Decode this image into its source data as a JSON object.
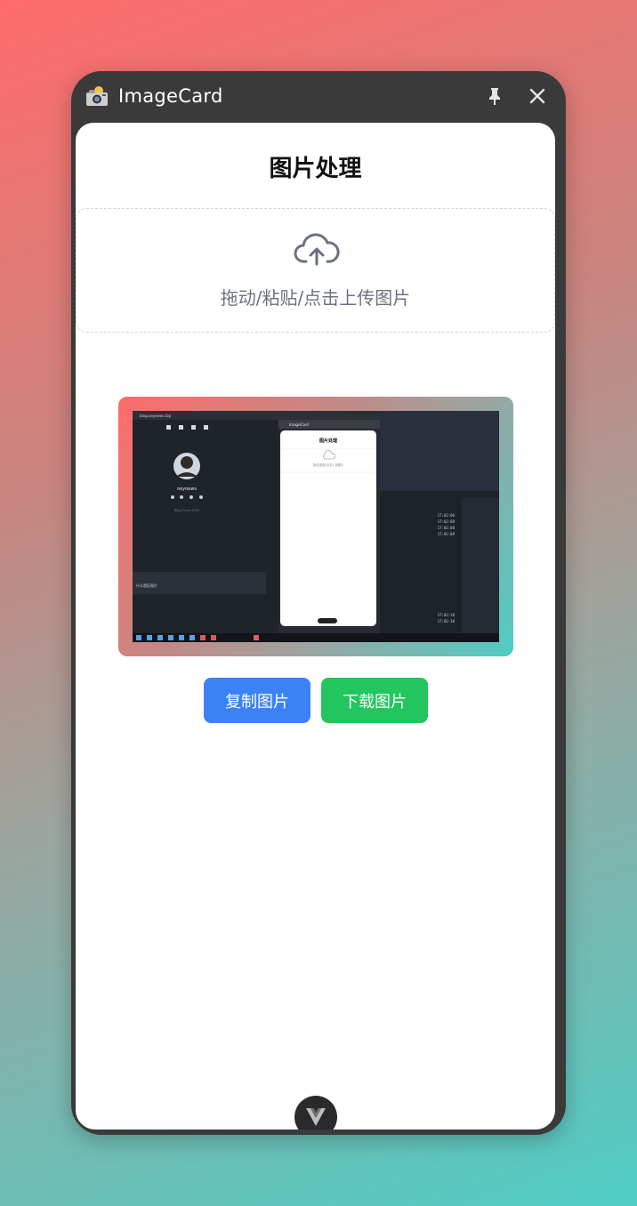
{
  "window": {
    "title": "ImageCard",
    "icons": {
      "app": "camera-icon",
      "pin": "pin-icon",
      "close": "close-icon"
    }
  },
  "main": {
    "page_title": "图片处理",
    "dropzone": {
      "icon": "cloud-upload-icon",
      "text": "拖动/粘贴/点击上传图片"
    },
    "preview": {
      "inner": {
        "tab_title": "blog.oeyoews.top",
        "profile_name": "oeyoews",
        "profile_sub": "Blog Since 2022",
        "card_title": "ImageCard",
        "card_heading": "图片处理",
        "card_hint": "拖动/粘贴/点击上传图片",
        "list_item": "什么是区图片",
        "times": [
          "17:02:06",
          "17:02:08",
          "17:02:08",
          "17:02:09",
          "17:02:10",
          "17:02:10"
        ]
      }
    },
    "buttons": {
      "copy": "复制图片",
      "download": "下载图片"
    }
  },
  "footer": {
    "logo": "vue-logo-icon"
  },
  "colors": {
    "copy_button": "#3b82f6",
    "download_button": "#22c55e",
    "window_frame": "#3a3a3a",
    "gradient_start": "#ff6b6b",
    "gradient_end": "#4ecdc4"
  }
}
